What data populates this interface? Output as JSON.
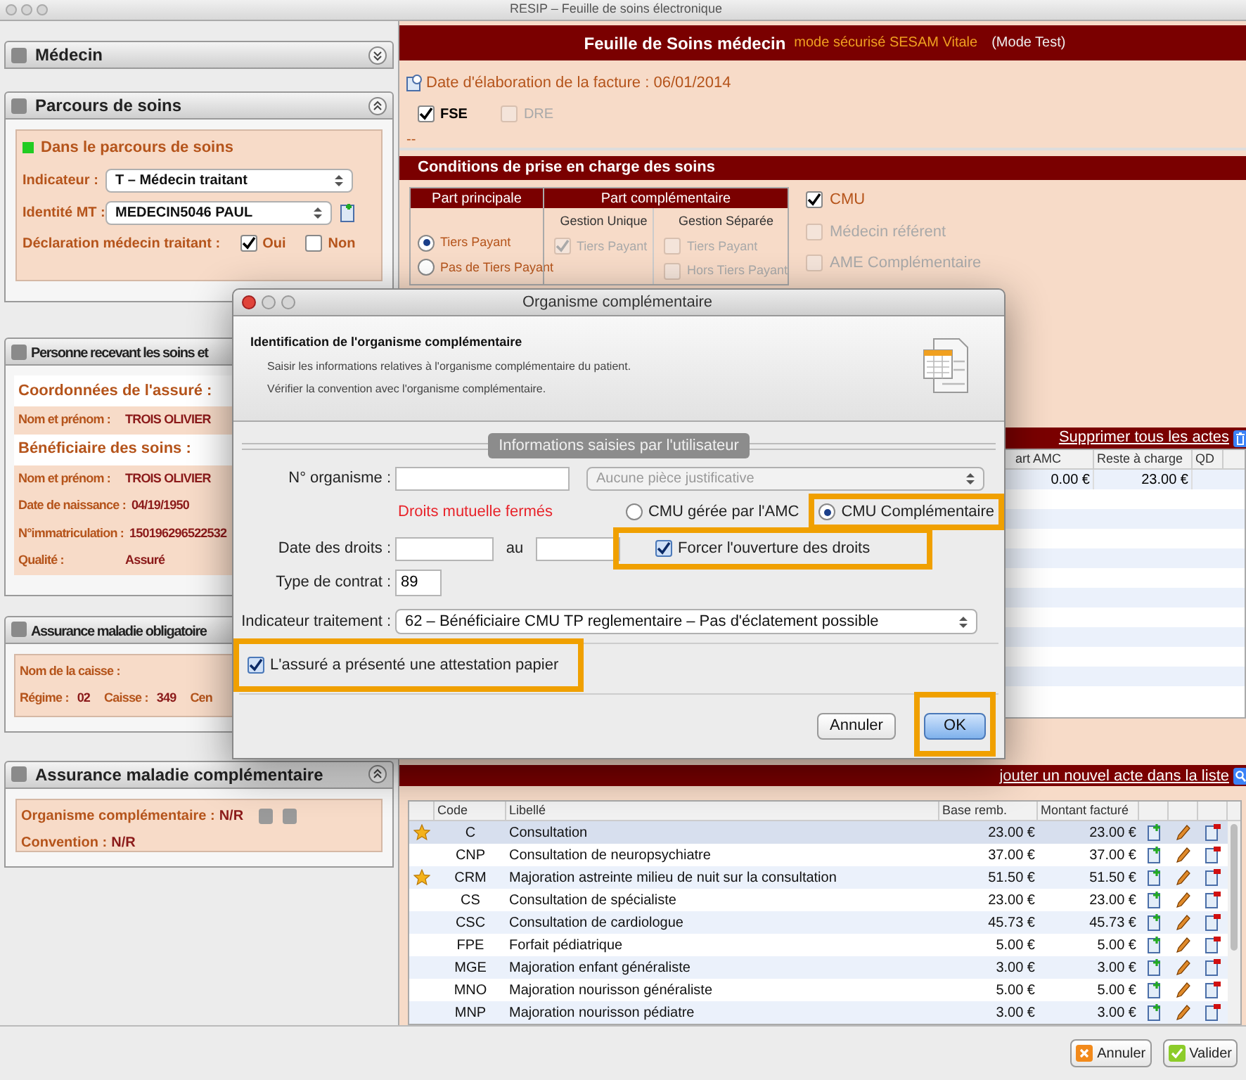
{
  "window": {
    "title": "RESIP – Feuille de soins électronique"
  },
  "medecin": {
    "title": "Médecin",
    "expanded": false
  },
  "parcours": {
    "title": "Parcours de soins",
    "expanded": true,
    "status": "Dans le parcours de soins",
    "fields": [
      {
        "label": "Indicateur :",
        "value": "T – Médecin traitant"
      },
      {
        "label": "Identité MT :",
        "value": "MEDECIN5046 PAUL"
      }
    ],
    "declaration": {
      "label": "Déclaration médecin traitant :",
      "options": [
        {
          "label": "Oui",
          "checked": true
        },
        {
          "label": "Non",
          "checked": false
        }
      ]
    }
  },
  "personne": {
    "title": "Personne recevant les soins et",
    "groups": [
      {
        "heading": "Coordonnées de l'assuré :",
        "rows": [
          {
            "label": "Nom et prénom :",
            "value": "TROIS OLIVIER"
          }
        ]
      },
      {
        "heading": "Bénéficiaire des soins :",
        "rows": [
          {
            "label": "Nom et prénom :",
            "value": "TROIS OLIVIER"
          },
          {
            "label": "Date de naissance :",
            "value": "04/19/1950"
          },
          {
            "label": "N°immatriculation :",
            "value": "150196296522532"
          },
          {
            "label": "Qualité :",
            "value": "Assuré"
          }
        ]
      }
    ]
  },
  "amo": {
    "title": "Assurance maladie obligatoire",
    "caisse_label": "Nom de la caisse :",
    "items": [
      {
        "label": "Régime :",
        "value": "02"
      },
      {
        "label": "Caisse :",
        "value": "349"
      },
      {
        "label": "Cen"
      }
    ]
  },
  "amc": {
    "title": "Assurance maladie complémentaire",
    "expanded": true,
    "rows": [
      {
        "label": "Organisme complémentaire :",
        "value": "N/R"
      },
      {
        "label": "Convention :",
        "value": "N/R"
      }
    ]
  },
  "feuille": {
    "title": "Feuille de Soins médecin",
    "mode": "mode sécurisé SESAM Vitale",
    "test": "(Mode Test)",
    "date": "Date d'élaboration de la facture : 06/01/2014",
    "types": [
      {
        "label": "FSE",
        "checked": true,
        "disabled": false
      },
      {
        "label": "DRE",
        "checked": false,
        "disabled": true
      }
    ],
    "dash": "--"
  },
  "conditions": {
    "title": "Conditions de prise en charge des soins",
    "principale": {
      "title": "Part principale",
      "options": [
        {
          "label": "Tiers Payant",
          "selected": true
        },
        {
          "label": "Pas de Tiers Payant",
          "selected": false
        }
      ]
    },
    "complementaire": {
      "title": "Part complémentaire",
      "groups": [
        {
          "title": "Gestion Unique",
          "options": [
            {
              "label": "Tiers Payant",
              "checked": true,
              "disabled": true
            }
          ]
        },
        {
          "title": "Gestion Séparée",
          "options": [
            {
              "label": "Tiers Payant",
              "checked": false,
              "disabled": true
            },
            {
              "label": "Hors Tiers Payant",
              "checked": false,
              "disabled": true
            }
          ]
        }
      ]
    },
    "flags": [
      {
        "label": "CMU",
        "checked": true,
        "disabled": false
      },
      {
        "label": "Médecin référent",
        "checked": false,
        "disabled": true
      },
      {
        "label": "AME Complémentaire",
        "checked": false,
        "disabled": true
      }
    ]
  },
  "actes": {
    "delete_link": "Supprimer tous les actes",
    "columns": [
      "art AMC",
      "Reste à charge",
      "QD"
    ],
    "rows": [
      {
        "cells": [
          "0.00 €",
          "23.00 €"
        ]
      }
    ],
    "add_link": "jouter un nouvel acte dans la liste"
  },
  "catalogue": {
    "columns": [
      "Code",
      "Libellé",
      "Base remb.",
      "Montant facturé"
    ],
    "rows": [
      {
        "favorite": true,
        "selected": true,
        "code": "C",
        "label": "Consultation",
        "base": "23.00 €",
        "montant": "23.00 €"
      },
      {
        "favorite": false,
        "selected": false,
        "code": "CNP",
        "label": "Consultation de neuropsychiatre",
        "base": "37.00 €",
        "montant": "37.00 €"
      },
      {
        "favorite": true,
        "selected": false,
        "code": "CRM",
        "label": "Majoration astreinte milieu de nuit sur la consultation",
        "base": "51.50 €",
        "montant": "51.50 €"
      },
      {
        "favorite": false,
        "selected": false,
        "code": "CS",
        "label": "Consultation de spécialiste",
        "base": "23.00 €",
        "montant": "23.00 €"
      },
      {
        "favorite": false,
        "selected": false,
        "code": "CSC",
        "label": "Consultation de cardiologue",
        "base": "45.73 €",
        "montant": "45.73 €"
      },
      {
        "favorite": false,
        "selected": false,
        "code": "FPE",
        "label": "Forfait pédiatrique",
        "base": "5.00 €",
        "montant": "5.00 €"
      },
      {
        "favorite": false,
        "selected": false,
        "code": "MGE",
        "label": "Majoration enfant généraliste",
        "base": "3.00 €",
        "montant": "3.00 €"
      },
      {
        "favorite": false,
        "selected": false,
        "code": "MNO",
        "label": "Majoration nourisson généraliste",
        "base": "5.00 €",
        "montant": "5.00 €"
      },
      {
        "favorite": false,
        "selected": false,
        "code": "MNP",
        "label": "Majoration nourisson pédiatre",
        "base": "3.00 €",
        "montant": "3.00 €"
      }
    ]
  },
  "footer_buttons": [
    {
      "label": "Annuler",
      "kind": "cancel"
    },
    {
      "label": "Valider",
      "kind": "ok"
    }
  ],
  "dialog": {
    "title": "Organisme complémentaire",
    "heading": "Identification de l'organisme complémentaire",
    "lines": [
      "Saisir les informations relatives à l'organisme complémentaire du patient.",
      "Vérifier la convention avec l'organisme complémentaire."
    ],
    "section": "Informations saisies par l'utilisateur",
    "organisme_label": "N° organisme :",
    "piece": {
      "value": "Aucune pièce justificative",
      "disabled": true
    },
    "status": "Droits mutuelle fermés",
    "cmu_options": [
      {
        "label": "CMU gérée par l'AMC",
        "selected": false,
        "highlighted": false
      },
      {
        "label": "CMU Complémentaire",
        "selected": true,
        "highlighted": true
      }
    ],
    "dates_label": "Date des droits :",
    "between": "au",
    "force": {
      "label": "Forcer l'ouverture des droits",
      "checked": true,
      "highlighted": true
    },
    "contrat": {
      "label": "Type de contrat :",
      "value": "89"
    },
    "indicateur": {
      "label": "Indicateur traitement :",
      "value": "62 – Bénéficiaire CMU TP reglementaire – Pas d'éclatement possible"
    },
    "attestation": {
      "label": "L'assuré a présenté une attestation papier",
      "checked": true,
      "highlighted": true
    },
    "buttons": [
      {
        "label": "Annuler",
        "kind": "cancel",
        "highlighted": false
      },
      {
        "label": "OK",
        "kind": "default",
        "highlighted": true
      }
    ]
  }
}
